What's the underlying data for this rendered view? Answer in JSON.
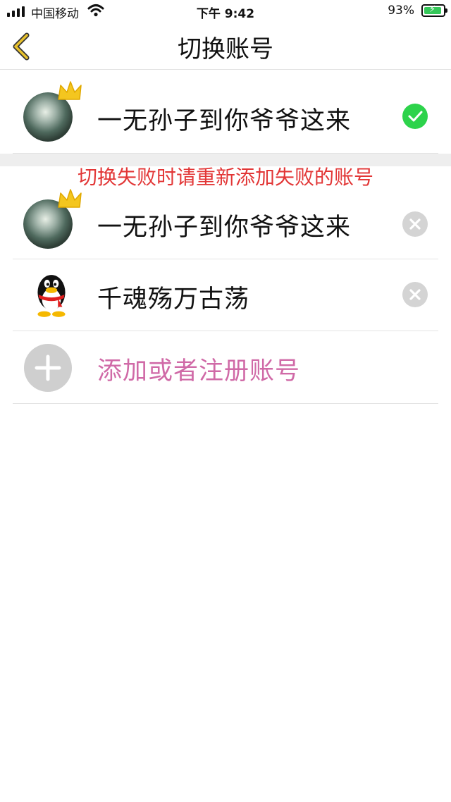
{
  "status_bar": {
    "carrier": "中国移动",
    "time": "下午 9:42",
    "battery_percent": "93%",
    "battery_level": 0.93
  },
  "navbar": {
    "title": "切换账号",
    "back_icon": "chevron-left-icon"
  },
  "current_account": {
    "name": "一无孙子到你爷爷这来",
    "status_icon": "check-circle-icon",
    "crown_icon": "crown-icon"
  },
  "notice": "切换失败时请重新添加失败的账号",
  "accounts": [
    {
      "name": "一无孙子到你爷爷这来",
      "avatar": "photo-avatar",
      "action_icon": "close-circle-icon"
    },
    {
      "name": "千魂殇万古荡",
      "avatar": "qq-penguin-avatar",
      "action_icon": "close-circle-icon"
    }
  ],
  "add_account": {
    "label": "添加或者注册账号",
    "icon": "plus-icon"
  },
  "colors": {
    "accent_yellow": "#e8c12c",
    "check_green": "#2dd34b",
    "notice_red": "#e23636",
    "add_pink": "#d06aa7"
  }
}
